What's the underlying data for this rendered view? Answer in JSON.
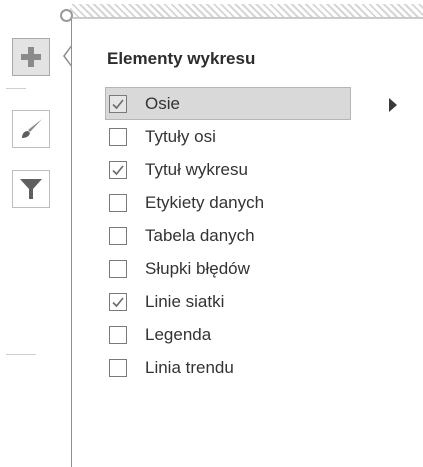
{
  "panel": {
    "title": "Elementy wykresu",
    "items": [
      {
        "label": "Osie",
        "checked": true,
        "highlighted": true,
        "has_submenu": true
      },
      {
        "label": "Tytuły osi",
        "checked": false
      },
      {
        "label": "Tytuł wykresu",
        "checked": true
      },
      {
        "label": "Etykiety danych",
        "checked": false
      },
      {
        "label": "Tabela danych",
        "checked": false
      },
      {
        "label": "Słupki błędów",
        "checked": false
      },
      {
        "label": "Linie siatki",
        "checked": true
      },
      {
        "label": "Legenda",
        "checked": false
      },
      {
        "label": "Linia trendu",
        "checked": false
      }
    ]
  },
  "side_tools": [
    {
      "icon": "plus-icon",
      "name": "chart-elements-button",
      "active": true
    },
    {
      "icon": "brush-icon",
      "name": "chart-styles-button",
      "active": false
    },
    {
      "icon": "funnel-icon",
      "name": "chart-filters-button",
      "active": false
    }
  ],
  "colors": {
    "highlight": "#d9d9d9",
    "checkmark": "#6b6b6b",
    "icon_gray": "#8a8a8a",
    "funnel": "#5f5f5f"
  }
}
